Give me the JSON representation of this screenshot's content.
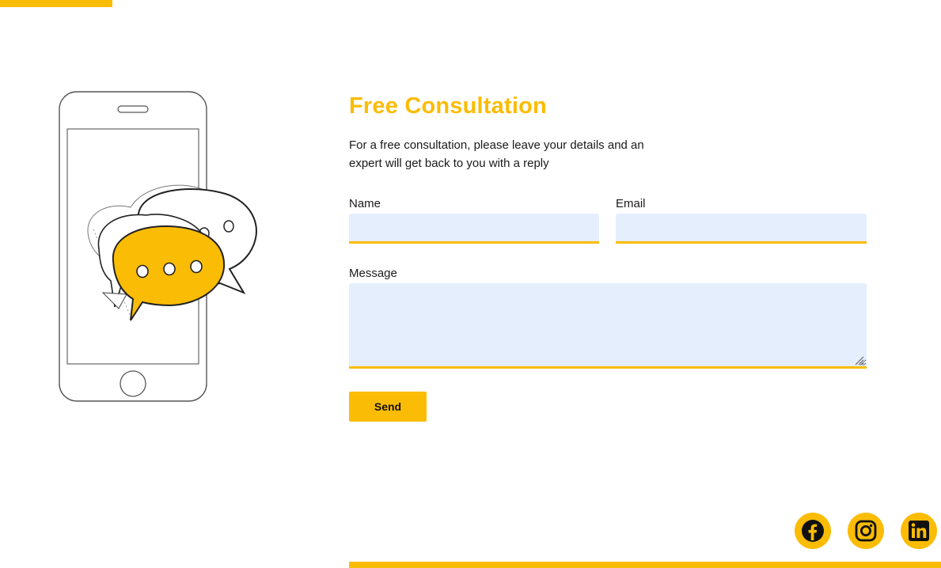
{
  "form": {
    "title": "Free Consultation",
    "subtitle": "For a free consultation, please leave your details and an expert will get back to you with a reply",
    "name_label": "Name",
    "name_value": "",
    "email_label": "Email",
    "email_value": "",
    "message_label": "Message",
    "message_value": "",
    "send_label": "Send"
  },
  "social": [
    {
      "name": "facebook-icon"
    },
    {
      "name": "instagram-icon"
    },
    {
      "name": "linkedin-icon"
    }
  ],
  "colors": {
    "accent": "#FBBC05",
    "input_bg": "#E5EEFC",
    "text": "#1a1a1a"
  }
}
